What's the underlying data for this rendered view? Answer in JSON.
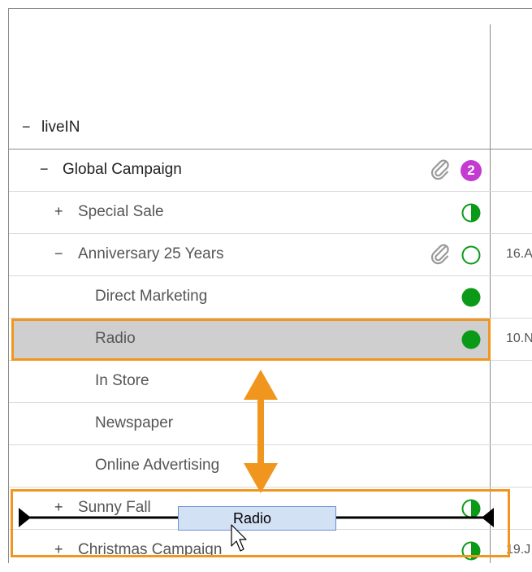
{
  "tree": {
    "rows": [
      {
        "toggle": "−",
        "label": "liveIN",
        "date": "",
        "status": "",
        "attachment": false,
        "badge": ""
      },
      {
        "toggle": "−",
        "label": "Global Campaign",
        "date": "",
        "status": "",
        "attachment": true,
        "badge": "2"
      },
      {
        "toggle": "+",
        "label": "Special Sale",
        "date": "",
        "status": "half",
        "attachment": false,
        "badge": ""
      },
      {
        "toggle": "−",
        "label": "Anniversary 25 Years",
        "date": "16.A",
        "status": "empty",
        "attachment": true,
        "badge": ""
      },
      {
        "toggle": "",
        "label": "Direct Marketing",
        "date": "",
        "status": "full",
        "attachment": false,
        "badge": ""
      },
      {
        "toggle": "",
        "label": "Radio",
        "date": "10.N",
        "status": "full",
        "attachment": false,
        "badge": ""
      },
      {
        "toggle": "",
        "label": "In Store",
        "date": "",
        "status": "",
        "attachment": false,
        "badge": ""
      },
      {
        "toggle": "",
        "label": "Newspaper",
        "date": "",
        "status": "",
        "attachment": false,
        "badge": ""
      },
      {
        "toggle": "",
        "label": "Online Advertising",
        "date": "",
        "status": "",
        "attachment": false,
        "badge": ""
      },
      {
        "toggle": "+",
        "label": "Sunny Fall",
        "date": "",
        "status": "half",
        "attachment": false,
        "badge": ""
      },
      {
        "toggle": "+",
        "label": "Christmas Campaign",
        "date": "19.J",
        "status": "half",
        "attachment": false,
        "badge": ""
      }
    ]
  },
  "drag": {
    "ghost_label": "Radio"
  },
  "colors": {
    "status_green": "#0a9a18",
    "highlight_orange": "#f0961e",
    "badge_purple": "#c33bd1",
    "selected_row_bg": "#cfcfcf"
  }
}
